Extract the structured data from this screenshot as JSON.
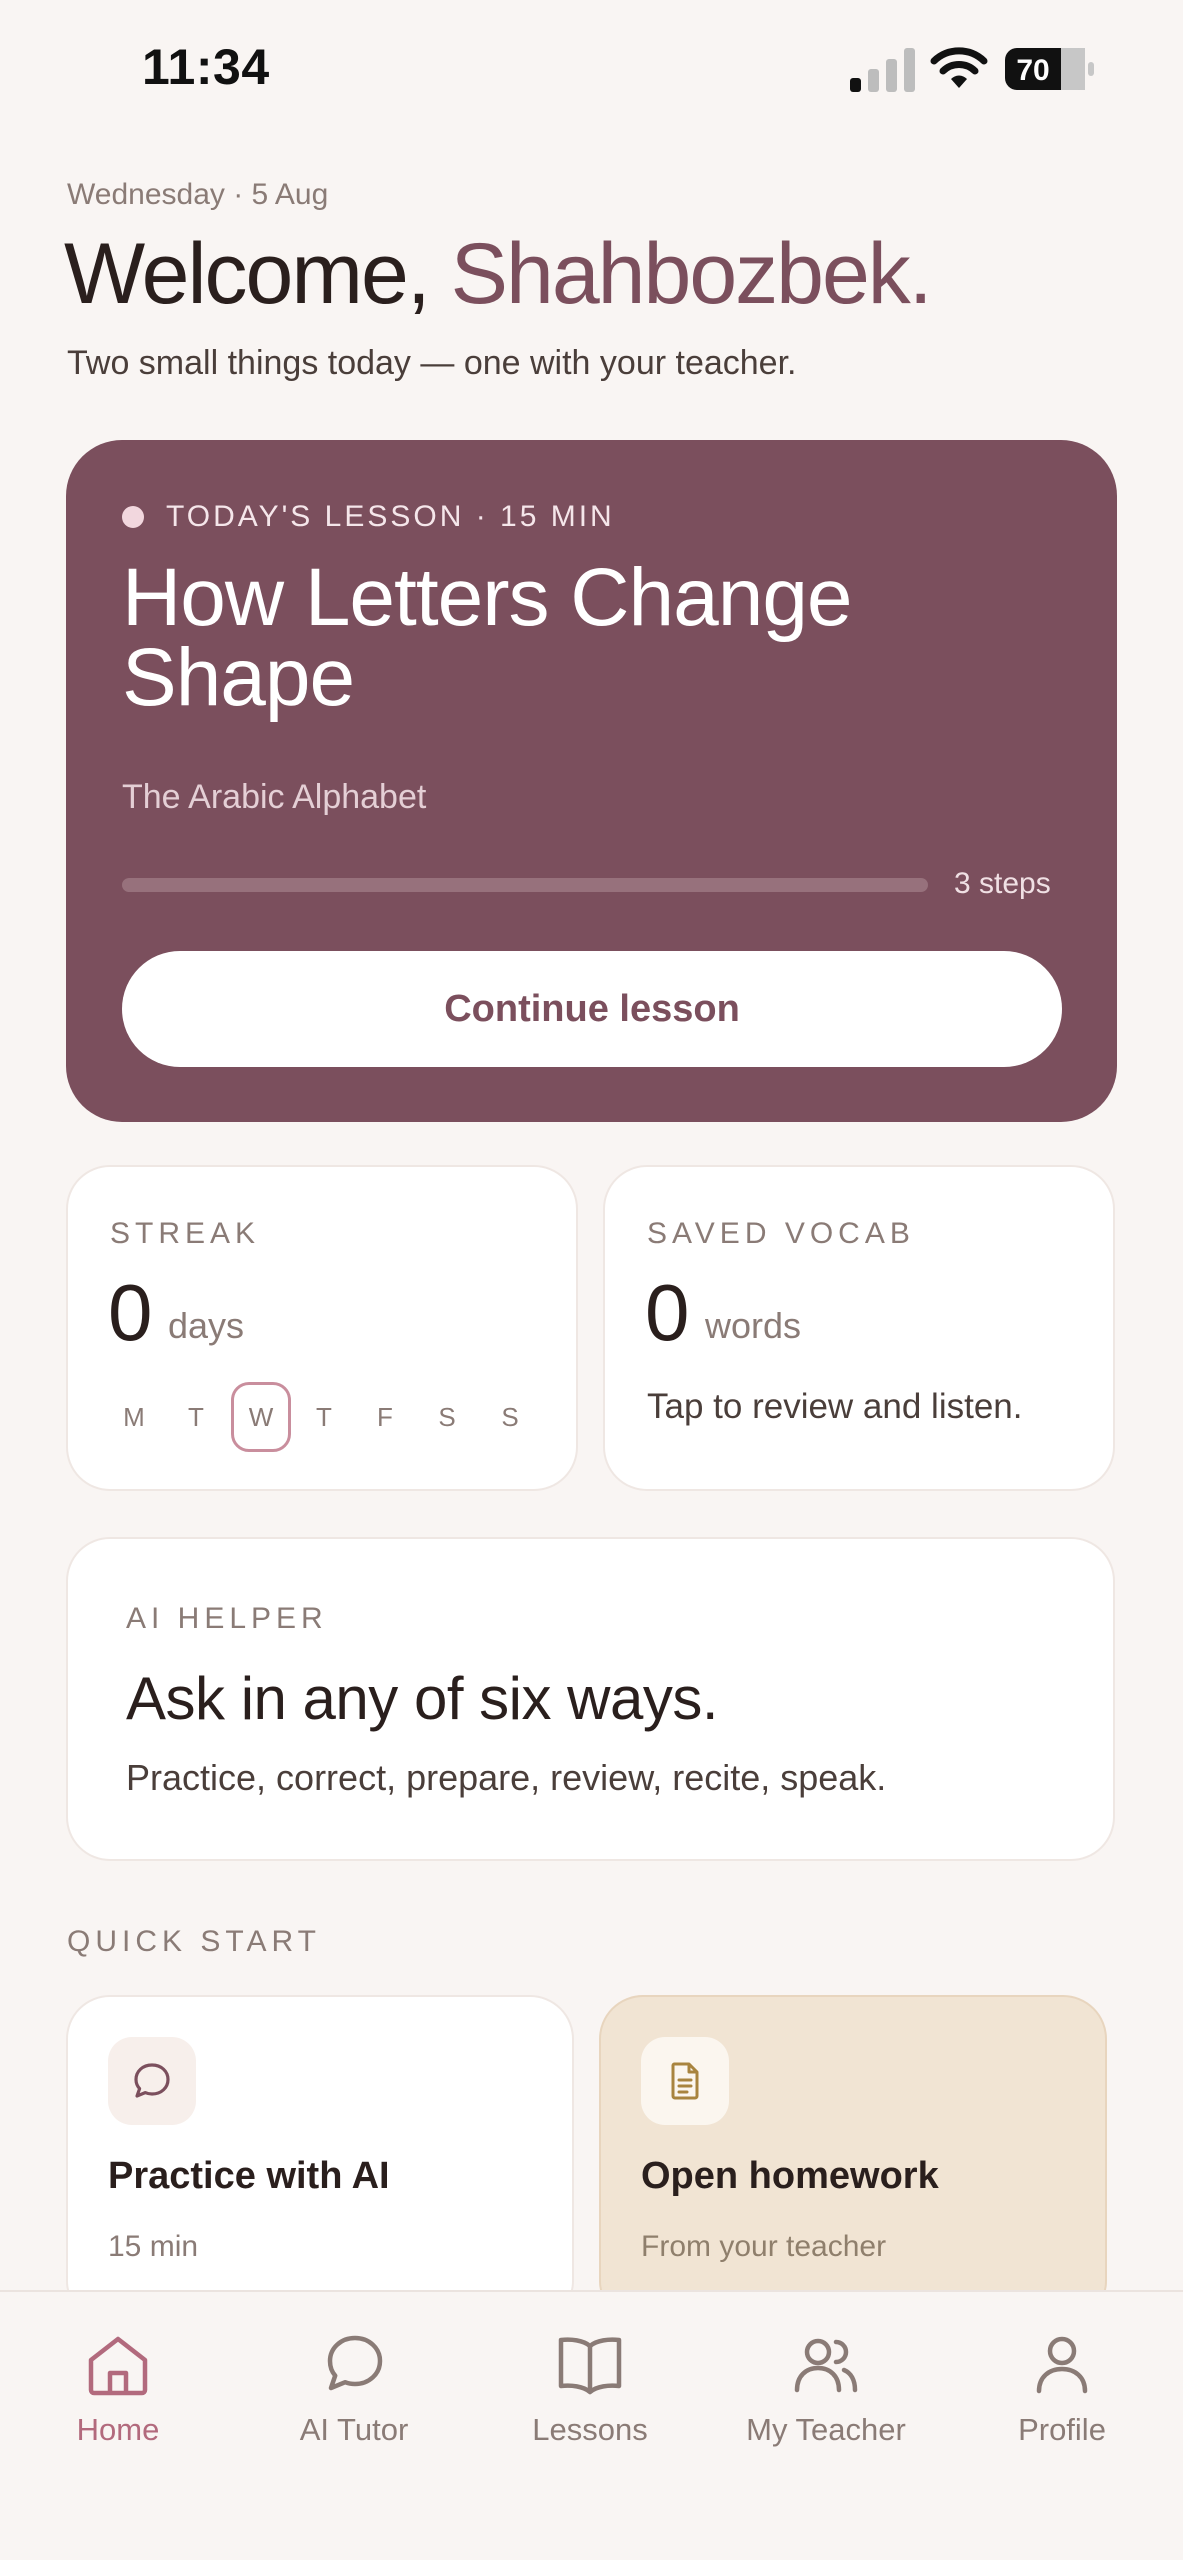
{
  "status_bar": {
    "time": "11:34",
    "battery": "70"
  },
  "header": {
    "date": "Wednesday · 5 Aug",
    "welcome_prefix": "Welcome, ",
    "user_name": "Shahbozbek.",
    "subtitle": "Two small things today — one with your teacher."
  },
  "lesson": {
    "meta": "TODAY'S LESSON · 15 MIN",
    "title": "How Letters Change Shape",
    "course": "The Arabic Alphabet",
    "progress": 0,
    "steps": "3 steps",
    "cta": "Continue lesson"
  },
  "streak": {
    "label": "STREAK",
    "value": "0",
    "unit": "days",
    "days": [
      "M",
      "T",
      "W",
      "T",
      "F",
      "S",
      "S"
    ],
    "today_index": 2
  },
  "vocab": {
    "label": "SAVED VOCAB",
    "value": "0",
    "unit": "words",
    "hint": "Tap to review and listen."
  },
  "ai_helper": {
    "label": "AI HELPER",
    "title": "Ask in any of six ways.",
    "text": "Practice, correct, prepare, review, recite, speak."
  },
  "quick_start": {
    "label": "QUICK START",
    "items": [
      {
        "title": "Practice with AI",
        "subtitle": "15 min",
        "icon": "chat-bubble-icon"
      },
      {
        "title": "Open homework",
        "subtitle": "From your teacher",
        "icon": "document-icon"
      }
    ]
  },
  "nav": {
    "items": [
      {
        "label": "Home",
        "icon": "home-icon",
        "active": true
      },
      {
        "label": "AI Tutor",
        "icon": "chat-bubble-icon",
        "active": false
      },
      {
        "label": "Lessons",
        "icon": "book-icon",
        "active": false
      },
      {
        "label": "My Teacher",
        "icon": "people-icon",
        "active": false
      },
      {
        "label": "Profile",
        "icon": "person-icon",
        "active": false
      }
    ]
  },
  "colors": {
    "accent": "#7b4f5d",
    "active_nav": "#b26a7d",
    "background": "#f9f5f3",
    "homework_card": "#f1e4d3"
  }
}
